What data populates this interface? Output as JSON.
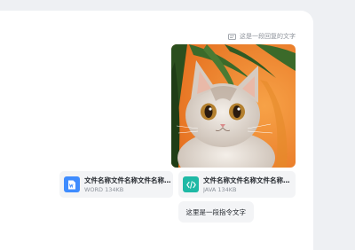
{
  "chat": {
    "reply_hint": "这是一段回复的文字",
    "image": {
      "subject": "cat-photo",
      "colors": {
        "background": "#f0862e",
        "leaf": "#2f5a24",
        "fur": "#e8e2dc"
      }
    },
    "files": [
      {
        "name": "文件名称文件名称文件名称文件名称",
        "meta": "WORD 134KB",
        "icon": "word-icon",
        "color": "#3f8cfe"
      },
      {
        "name": "文件名称文件名称文件名称文件名称",
        "meta": "JAVA 134KB",
        "icon": "code-icon",
        "color": "#1fb9a5"
      }
    ],
    "command_text": "这里是一段指令文字"
  }
}
